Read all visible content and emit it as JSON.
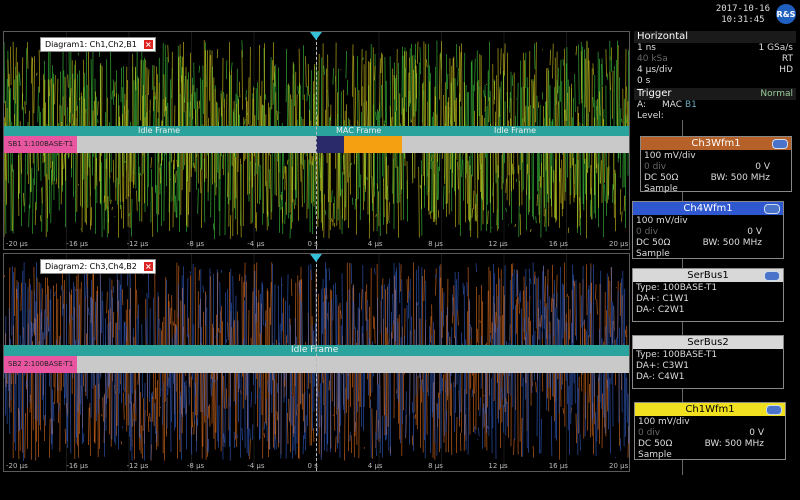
{
  "datetime": {
    "date": "2017-10-16",
    "time": "10:31:45"
  },
  "logo": "R&S",
  "diagram1": {
    "title": "Diagram1: Ch1,Ch2,B1",
    "close": "×",
    "bus_label": "SB1 1:100BASE-T1",
    "bands": [
      {
        "label": "Idle Frame"
      },
      {
        "label": "MAC Frame"
      },
      {
        "label": "Idle Frame"
      }
    ]
  },
  "diagram2": {
    "title": "Diagram2: Ch3,Ch4,B2",
    "close": "×",
    "bus_label": "SB2 2:100BASE-T1",
    "bands": [
      {
        "label": "Idle Frame"
      }
    ]
  },
  "ticks": [
    "-20 µs",
    "-16 µs",
    "-12 µs",
    "-8 µs",
    "-4 µs",
    "0 s",
    "4 µs",
    "8 µs",
    "12 µs",
    "16 µs",
    "20 µs"
  ],
  "horizontal": {
    "title": "Horizontal",
    "rows": [
      {
        "left": "1 ns",
        "right": "1 GSa/s",
        "dim": false
      },
      {
        "left": "40 kSa",
        "right": "RT",
        "dim": true
      },
      {
        "left": "4 µs/div",
        "right": "HD",
        "dim": false
      },
      {
        "left": "0 s",
        "right": "",
        "dim": false
      }
    ]
  },
  "trigger": {
    "title": "Trigger",
    "mode": "Normal",
    "source_label": "A:",
    "source": "MAC",
    "source_bus": "B1",
    "level_label": "Level:"
  },
  "ch3": {
    "title": "Ch3Wfm1",
    "vdiv": "100 mV/div",
    "offset": "0 div",
    "pos": "0 V",
    "coupling": "DC 50Ω",
    "bw": "BW: 500 MHz",
    "mode": "Sample",
    "color": "#e07020"
  },
  "ch4": {
    "title": "Ch4Wfm1",
    "vdiv": "100 mV/div",
    "offset": "0 div",
    "pos": "0 V",
    "coupling": "DC 50Ω",
    "bw": "BW: 500 MHz",
    "mode": "Sample",
    "color": "#3a6be0"
  },
  "serbus1": {
    "title": "SerBus1",
    "type": "Type: 100BASE-T1",
    "dap": "DA+: C1W1",
    "dam": "DA-: C2W1"
  },
  "serbus2": {
    "title": "SerBus2",
    "type": "Type: 100BASE-T1",
    "dap": "DA+: C3W1",
    "dam": "DA-: C4W1"
  },
  "ch1": {
    "title": "Ch1Wfm1",
    "vdiv": "100 mV/div",
    "offset": "0 div",
    "pos": "0 V",
    "coupling": "DC 50Ω",
    "bw": "BW: 500 MHz",
    "mode": "Sample",
    "color": "#f0e020"
  },
  "colors": {
    "ch1": "#f0e020",
    "ch2": "#3ec83e",
    "ch3": "#e07020",
    "ch4": "#3a6be0",
    "band": "#29a39b",
    "mac": "#f5a010"
  }
}
